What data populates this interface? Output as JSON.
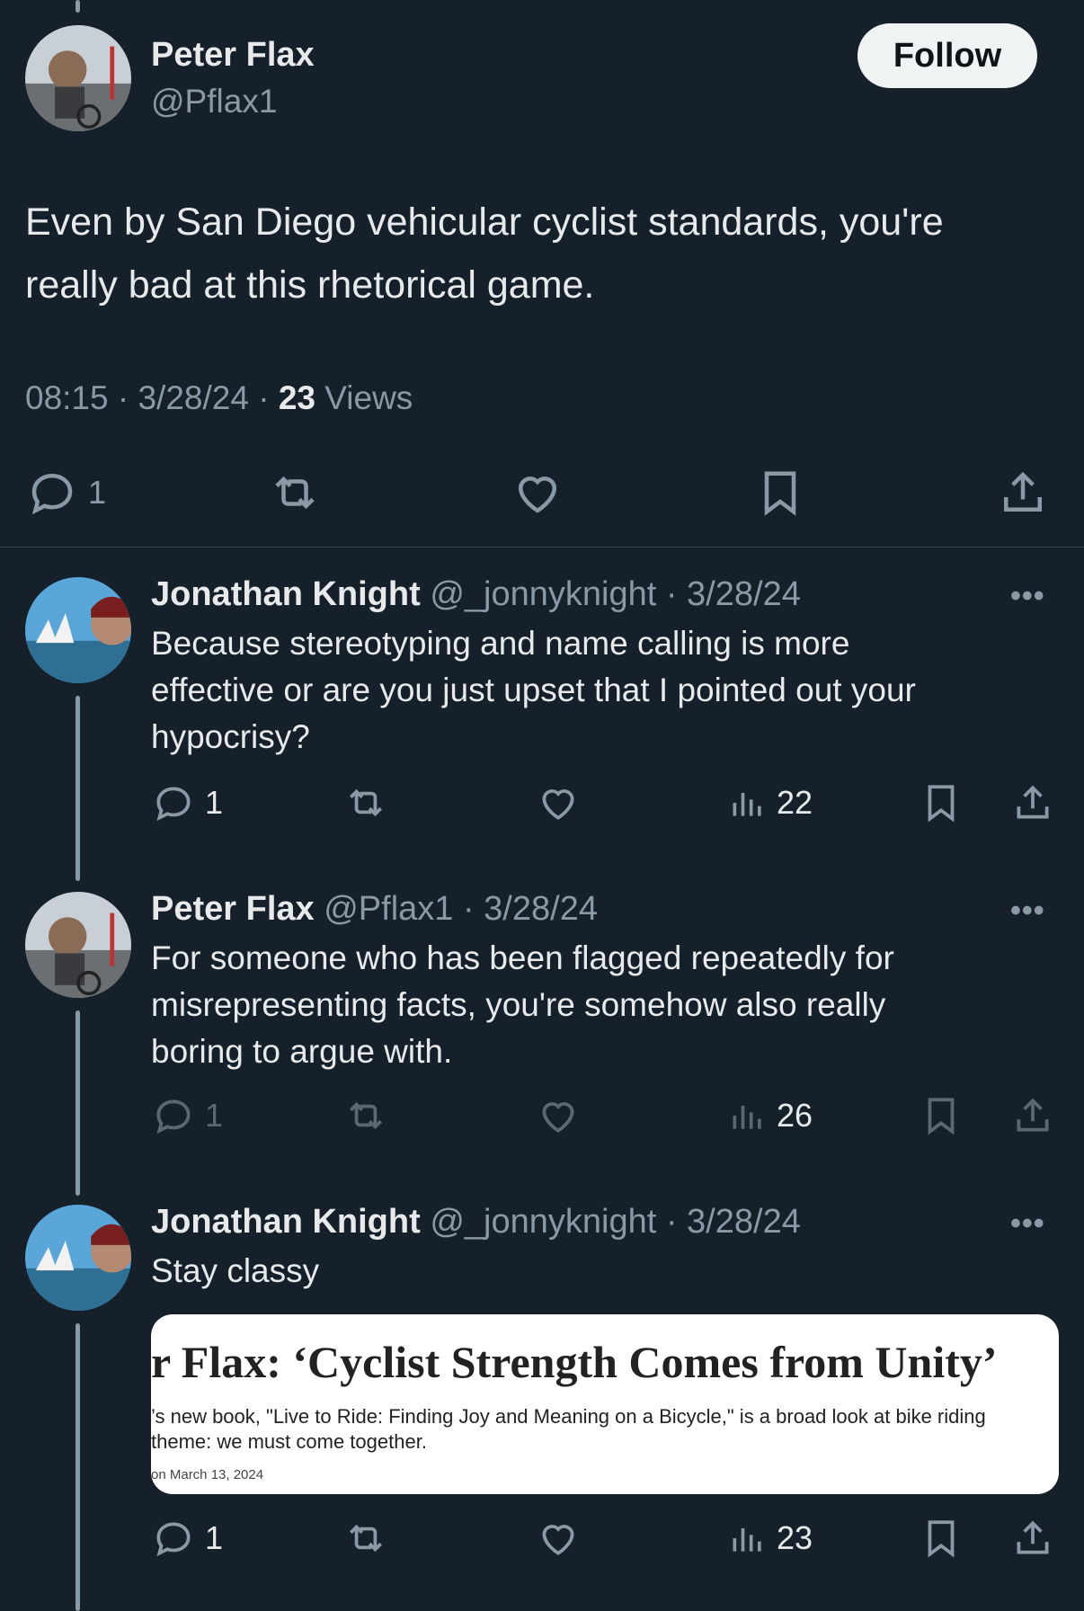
{
  "main_tweet": {
    "author_name": "Peter Flax",
    "handle": "@Pflax1",
    "follow_label": "Follow",
    "text_line1": "Even by San Diego vehicular cyclist standards, you're",
    "text_line2": "really bad at this rhetorical game.",
    "time": "08:15",
    "date": "3/28/24",
    "views_count": "23",
    "views_label": "Views",
    "reply_count": "1"
  },
  "replies": [
    {
      "author_name": "Jonathan Knight",
      "meta": "@_jonnyknight · 3/28/24",
      "text_lines": [
        "Because stereotyping and name calling is more",
        "effective or are you just upset that I pointed out your",
        "hypocrisy?"
      ],
      "reply_count": "1",
      "views": "22"
    },
    {
      "author_name": "Peter Flax",
      "meta": "@Pflax1 · 3/28/24",
      "text_lines": [
        "For someone who has been flagged repeatedly for",
        "misrepresenting facts, you're somehow also really",
        "boring to argue with."
      ],
      "reply_count": "1",
      "views": "26"
    },
    {
      "author_name": "Jonathan Knight",
      "meta": "@_jonnyknight · 3/28/24",
      "text_lines": [
        "Stay classy"
      ],
      "reply_count": "1",
      "views": "23",
      "card": {
        "title": "r Flax: ‘Cyclist Strength Comes from Unity’",
        "desc_line1": "’s new book, \"Live to Ride: Finding Joy and Meaning on a Bicycle,\" is a broad look at bike riding",
        "desc_line2": "theme: we must come together.",
        "date": "on March 13, 2024"
      }
    }
  ],
  "more_label": "•••",
  "colors": {
    "background": "#15202b",
    "text": "#e7e9ea",
    "muted": "#8b98a5",
    "divider": "#38444d"
  },
  "icons": [
    "reply-icon",
    "retweet-icon",
    "like-icon",
    "bookmark-icon",
    "share-icon",
    "views-icon",
    "more-icon"
  ]
}
